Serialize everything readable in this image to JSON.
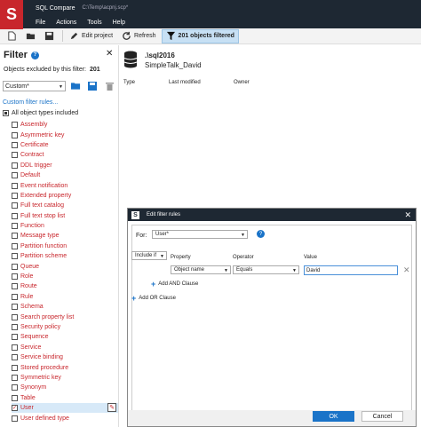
{
  "app": {
    "title": "SQL Compare",
    "path": "C:\\Temp\\acpnj.scp*"
  },
  "menu": [
    "File",
    "Actions",
    "Tools",
    "Help"
  ],
  "toolbar": {
    "edit_project": "Edit project",
    "refresh": "Refresh",
    "filtered": "201 objects filtered"
  },
  "filter": {
    "title": "Filter",
    "excluded_label": "Objects excluded by this filter:",
    "excluded_count": "201",
    "dropdown_value": "Custom*",
    "custom_rules_link": "Custom filter rules...",
    "all_types_label": "All object types included",
    "items": [
      "Assembly",
      "Asymmetric key",
      "Certificate",
      "Contract",
      "DDL trigger",
      "Default",
      "Event notification",
      "Extended property",
      "Full text catalog",
      "Full text stop list",
      "Function",
      "Message type",
      "Partition function",
      "Partition scheme",
      "Queue",
      "Role",
      "Route",
      "Rule",
      "Schema",
      "Search property list",
      "Security policy",
      "Sequence",
      "Service",
      "Service binding",
      "Stored procedure",
      "Symmetric key",
      "Synonym",
      "Table",
      "User",
      "User defined type"
    ],
    "checked_item": "User"
  },
  "database": {
    "server": ".\\sql2016",
    "name": "SimpleTalk_David"
  },
  "columns": [
    "Type",
    "Last modified",
    "Owner"
  ],
  "dialog": {
    "title": "Edit filter rules",
    "for_label": "For:",
    "for_value": "User*",
    "include_value": "Include if",
    "property_header": "Property",
    "operator_header": "Operator",
    "value_header": "Value",
    "property_value": "Object name",
    "operator_value": "Equals",
    "value_text": "David",
    "add_and": "Add AND Clause",
    "add_or": "Add OR Clause",
    "ok": "OK",
    "cancel": "Cancel"
  },
  "colors": {
    "brand": "#c8262c",
    "dark": "#1e2833",
    "accent": "#1a73c8"
  }
}
